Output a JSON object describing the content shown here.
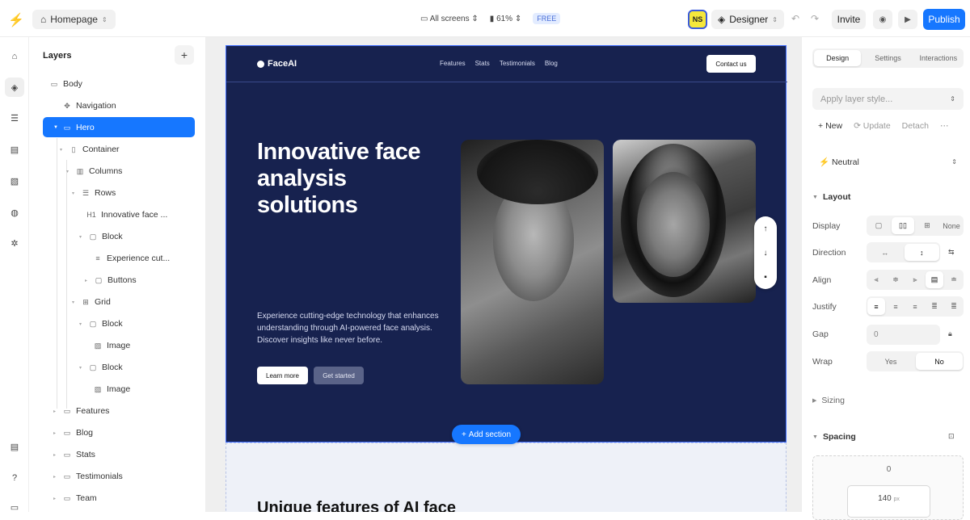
{
  "topbar": {
    "logo": "⚡",
    "page_name": "Homepage",
    "screens": "All screens",
    "zoom": "61%",
    "plan_badge": "FREE",
    "avatar_initials": "NS",
    "mode": "Designer",
    "invite": "Invite",
    "publish": "Publish"
  },
  "layers": {
    "title": "Layers",
    "items": [
      {
        "label": "Body",
        "icon": "▭"
      },
      {
        "label": "Navigation",
        "icon": "✥"
      },
      {
        "label": "Hero",
        "icon": "▭"
      },
      {
        "label": "Container",
        "icon": "▯"
      },
      {
        "label": "Columns",
        "icon": "▥"
      },
      {
        "label": "Rows",
        "icon": "☰"
      },
      {
        "label": "Innovative face ...",
        "icon": "H1"
      },
      {
        "label": "Block",
        "icon": "▢"
      },
      {
        "label": "Experience cut...",
        "icon": "≡"
      },
      {
        "label": "Buttons",
        "icon": "▢"
      },
      {
        "label": "Grid",
        "icon": "⊞"
      },
      {
        "label": "Block",
        "icon": "▢"
      },
      {
        "label": "Image",
        "icon": "▨"
      },
      {
        "label": "Block",
        "icon": "▢"
      },
      {
        "label": "Image",
        "icon": "▨"
      },
      {
        "label": "Features",
        "icon": "▭"
      },
      {
        "label": "Blog",
        "icon": "▭"
      },
      {
        "label": "Stats",
        "icon": "▭"
      },
      {
        "label": "Testimonials",
        "icon": "▭"
      },
      {
        "label": "Team",
        "icon": "▭"
      }
    ]
  },
  "canvas": {
    "brand": "FaceAI",
    "nav_links": [
      "Features",
      "Stats",
      "Testimonials",
      "Blog"
    ],
    "contact": "Contact us",
    "headline": "Innovative face analysis solutions",
    "subtext": "Experience cutting-edge technology that enhances understanding through AI-powered face analysis. Discover insights like never before.",
    "btn_more": "Learn more",
    "btn_start": "Get started",
    "add_section": "Add section",
    "next_section_title": "Unique features of AI face"
  },
  "panel": {
    "tabs": [
      "Design",
      "Settings",
      "Interactions"
    ],
    "style_placeholder": "Apply layer style...",
    "style_new": "New",
    "style_update": "Update",
    "style_detach": "Detach",
    "style_theme": "Neutral",
    "layout_title": "Layout",
    "display_label": "Display",
    "display_none": "None",
    "direction_label": "Direction",
    "align_label": "Align",
    "justify_label": "Justify",
    "gap_label": "Gap",
    "gap_value": "0",
    "wrap_label": "Wrap",
    "wrap_yes": "Yes",
    "wrap_no": "No",
    "sizing_title": "Sizing",
    "spacing_title": "Spacing",
    "margin_top": "0",
    "padding_top": "140",
    "padding_unit": "px"
  },
  "colors": {
    "accent": "#1677ff",
    "hero_bg": "#17224f",
    "avatar_bg": "#f5e73b"
  }
}
